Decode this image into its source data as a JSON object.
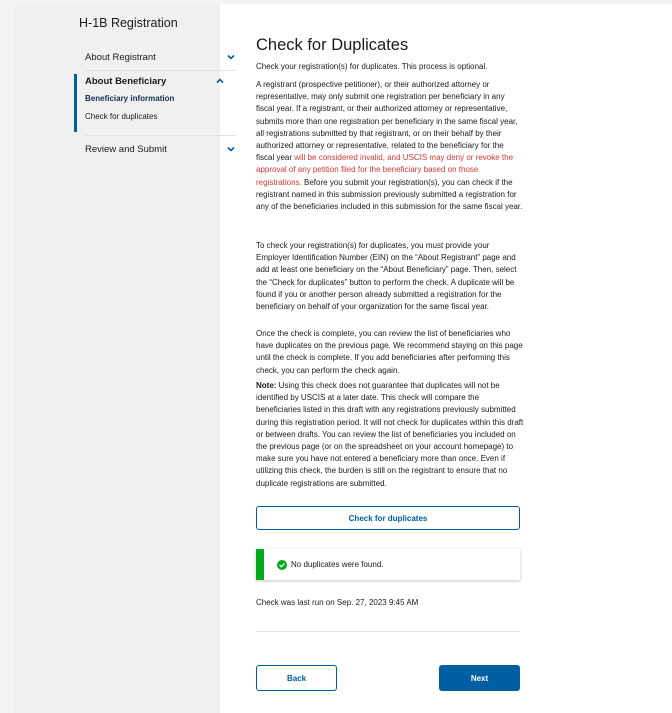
{
  "sidebar": {
    "title": "H-1B Registration",
    "items": [
      {
        "label": "About Registrant"
      },
      {
        "label": "About Beneficiary",
        "subitems": [
          "Beneficiary information",
          "Check for duplicates"
        ]
      },
      {
        "label": "Review and Submit"
      }
    ]
  },
  "main": {
    "title": "Check for Duplicates",
    "intro": "Check your registration(s) for duplicates. This process is optional.",
    "para1_a": "A registrant (prospective petitioner), or their authorized attorney or representative, may only submit one registration per beneficiary in any fiscal year. If a registrant, or their authorized attorney or representative, submits more than one registration per beneficiary in the same fiscal year, all registrations submitted by that registrant, or on their behalf by their authorized attorney or representative, related to the beneficiary for the fiscal year ",
    "para1_red": "will be considered invalid, and USCIS may deny or revoke the approval of any petition filed for the beneficiary based on those registrations.",
    "para1_b": " Before you submit your registration(s), you can check if the registrant named in this submission previously submitted a registration for any of the beneficiaries included in this submission for the same fiscal year.",
    "para2": "To check your registration(s) for duplicates, you must provide your Employer Identification Number (EIN) on the “About Registrant” page and add at least one beneficiary on the “About Beneficiary” page. Then, select the “Check for duplicates” button to perform the check. A duplicate will be found if you or another person already submitted a registration for the beneficiary on behalf of your organization for the same fiscal year.",
    "para3": "Once the check is complete, you can review the list of beneficiaries who have duplicates on the previous page. We recommend staying on this page until the check is complete. If you add beneficiaries after performing this check, you can perform the check again.",
    "note_label": "Note:",
    "note_text": " Using this check does not guarantee that duplicates will not be identified by USCIS at a later date. This check will compare the beneficiaries listed in this draft with any registrations previously submitted during this registration period. It will not check for duplicates within this draft or between drafts. You can review the list of beneficiaries you included on the previous page (or on the spreadsheet on your account homepage) to make sure you have not entered a beneficiary more than once. Even if utilizing this check, the burden is still on the registrant to ensure that no duplicate registrations are submitted.",
    "check_button": "Check for duplicates",
    "alert_text": "No duplicates were found.",
    "last_run": "Check was last run on Sep. 27, 2023 9:45 AM",
    "back_button": "Back",
    "next_button": "Next"
  },
  "colors": {
    "primary": "#005ea2",
    "success": "#00a91c",
    "error": "#d83933"
  }
}
